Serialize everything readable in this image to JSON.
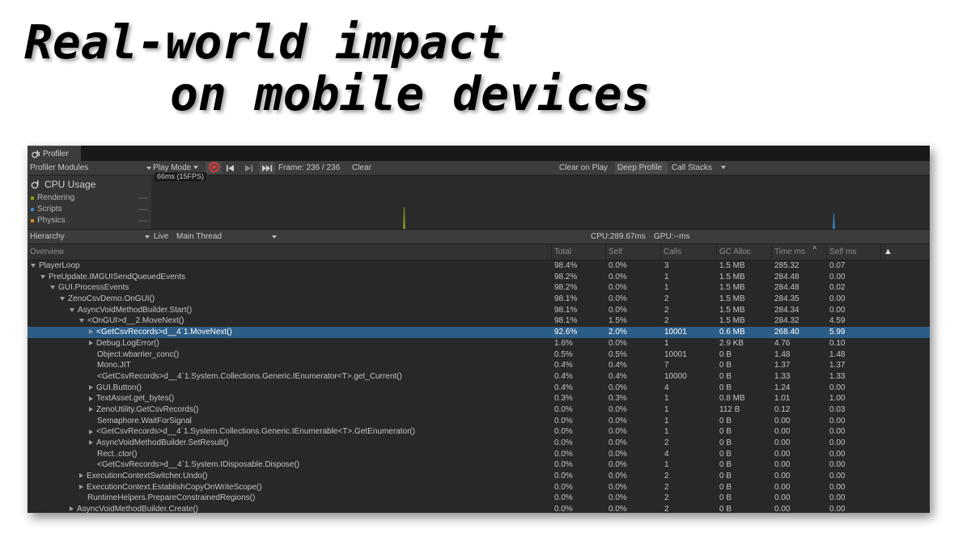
{
  "slide": {
    "title_line1": "Real-world impact",
    "title_line2": "on mobile devices"
  },
  "window": {
    "tab_label": "Profiler"
  },
  "toolbar": {
    "modules_label": "Profiler Modules",
    "play_mode": "Play Mode",
    "frame": "Frame: 236 / 236",
    "clear": "Clear",
    "clear_on_play": "Clear on Play",
    "deep_profile": "Deep Profile",
    "call_stacks": "Call Stacks"
  },
  "module": {
    "title": "CPU Usage",
    "graph_label": "66ms (15FPS)",
    "legend": [
      {
        "label": "Rendering",
        "color": "#8f9a1f"
      },
      {
        "label": "Scripts",
        "color": "#3b87c7"
      },
      {
        "label": "Physics",
        "color": "#d9892b"
      }
    ]
  },
  "hierarchy_bar": {
    "view": "Hierarchy",
    "live": "Live",
    "thread": "Main Thread",
    "cpu": "CPU:289.67ms",
    "gpu": "GPU:--ms"
  },
  "columns": [
    "Overview",
    "Total",
    "Self",
    "Calls",
    "GC Alloc",
    "Time ms",
    "Self ms",
    "▲"
  ],
  "rows": [
    {
      "name": "PlayerLoop",
      "indent": 0,
      "exp": "down",
      "total": "98.4%",
      "self": "0.0%",
      "calls": "3",
      "gc": "1.5 MB",
      "time": "285.32",
      "selfms": "0.07"
    },
    {
      "name": "PreUpdate.IMGUISendQueuedEvents",
      "indent": 1,
      "exp": "down",
      "total": "98.2%",
      "self": "0.0%",
      "calls": "1",
      "gc": "1.5 MB",
      "time": "284.48",
      "selfms": "0.00"
    },
    {
      "name": "GUI.ProcessEvents",
      "indent": 2,
      "exp": "down",
      "total": "98.2%",
      "self": "0.0%",
      "calls": "1",
      "gc": "1.5 MB",
      "time": "284.48",
      "selfms": "0.02"
    },
    {
      "name": "ZenoCsvDemo.OnGUI()",
      "indent": 3,
      "exp": "down",
      "total": "98.1%",
      "self": "0.0%",
      "calls": "2",
      "gc": "1.5 MB",
      "time": "284.35",
      "selfms": "0.00"
    },
    {
      "name": "AsyncVoidMethodBuilder.Start()",
      "indent": 4,
      "exp": "down",
      "total": "98.1%",
      "self": "0.0%",
      "calls": "2",
      "gc": "1.5 MB",
      "time": "284.34",
      "selfms": "0.00"
    },
    {
      "name": "<OnGUI>d__2.MoveNext()",
      "indent": 5,
      "exp": "down",
      "total": "98.1%",
      "self": "1.5%",
      "calls": "2",
      "gc": "1.5 MB",
      "time": "284.32",
      "selfms": "4.59"
    },
    {
      "name": "<GetCsvRecords>d__4`1.MoveNext()",
      "indent": 6,
      "exp": "right",
      "selected": true,
      "total": "92.6%",
      "self": "2.0%",
      "calls": "10001",
      "gc": "0.6 MB",
      "time": "268.40",
      "selfms": "5.99"
    },
    {
      "name": "Debug.LogError()",
      "indent": 6,
      "exp": "right",
      "total": "1.6%",
      "self": "0.0%",
      "calls": "1",
      "gc": "2.9 KB",
      "time": "4.76",
      "selfms": "0.10"
    },
    {
      "name": "Object.wbarrier_conc()",
      "indent": 6,
      "exp": "none",
      "total": "0.5%",
      "self": "0.5%",
      "calls": "10001",
      "gc": "0 B",
      "time": "1.48",
      "selfms": "1.48"
    },
    {
      "name": "Mono.JIT",
      "indent": 6,
      "exp": "none",
      "total": "0.4%",
      "self": "0.4%",
      "calls": "7",
      "gc": "0 B",
      "time": "1.37",
      "selfms": "1.37"
    },
    {
      "name": "<GetCsvRecords>d__4`1.System.Collections.Generic.IEnumerator<T>.get_Current()",
      "indent": 6,
      "exp": "none",
      "total": "0.4%",
      "self": "0.4%",
      "calls": "10000",
      "gc": "0 B",
      "time": "1.33",
      "selfms": "1.33"
    },
    {
      "name": "GUI.Button()",
      "indent": 6,
      "exp": "right",
      "total": "0.4%",
      "self": "0.0%",
      "calls": "4",
      "gc": "0 B",
      "time": "1.24",
      "selfms": "0.00"
    },
    {
      "name": "TextAsset.get_bytes()",
      "indent": 6,
      "exp": "right",
      "total": "0.3%",
      "self": "0.3%",
      "calls": "1",
      "gc": "0.8 MB",
      "time": "1.01",
      "selfms": "1.00"
    },
    {
      "name": "ZenoUtility.GetCsvRecords()",
      "indent": 6,
      "exp": "right",
      "total": "0.0%",
      "self": "0.0%",
      "calls": "1",
      "gc": "112 B",
      "time": "0.12",
      "selfms": "0.03"
    },
    {
      "name": "Semaphore.WaitForSignal",
      "indent": 6,
      "exp": "none",
      "total": "0.0%",
      "self": "0.0%",
      "calls": "1",
      "gc": "0 B",
      "time": "0.00",
      "selfms": "0.00"
    },
    {
      "name": "<GetCsvRecords>d__4`1.System.Collections.Generic.IEnumerable<T>.GetEnumerator()",
      "indent": 6,
      "exp": "right",
      "total": "0.0%",
      "self": "0.0%",
      "calls": "1",
      "gc": "0 B",
      "time": "0.00",
      "selfms": "0.00"
    },
    {
      "name": "AsyncVoidMethodBuilder.SetResult()",
      "indent": 6,
      "exp": "right",
      "total": "0.0%",
      "self": "0.0%",
      "calls": "2",
      "gc": "0 B",
      "time": "0.00",
      "selfms": "0.00"
    },
    {
      "name": "Rect..ctor()",
      "indent": 6,
      "exp": "none",
      "total": "0.0%",
      "self": "0.0%",
      "calls": "4",
      "gc": "0 B",
      "time": "0.00",
      "selfms": "0.00"
    },
    {
      "name": "<GetCsvRecords>d__4`1.System.IDisposable.Dispose()",
      "indent": 6,
      "exp": "none",
      "total": "0.0%",
      "self": "0.0%",
      "calls": "1",
      "gc": "0 B",
      "time": "0.00",
      "selfms": "0.00"
    },
    {
      "name": "ExecutionContextSwitcher.Undo()",
      "indent": 5,
      "exp": "right",
      "total": "0.0%",
      "self": "0.0%",
      "calls": "2",
      "gc": "0 B",
      "time": "0.00",
      "selfms": "0.00"
    },
    {
      "name": "ExecutionContext.EstablishCopyOnWriteScope()",
      "indent": 5,
      "exp": "right",
      "total": "0.0%",
      "self": "0.0%",
      "calls": "2",
      "gc": "0 B",
      "time": "0.00",
      "selfms": "0.00"
    },
    {
      "name": "RuntimeHelpers.PrepareConstrainedRegions()",
      "indent": 5,
      "exp": "none",
      "total": "0.0%",
      "self": "0.0%",
      "calls": "2",
      "gc": "0 B",
      "time": "0.00",
      "selfms": "0.00"
    },
    {
      "name": "AsyncVoidMethodBuilder.Create()",
      "indent": 4,
      "exp": "right",
      "total": "0.0%",
      "self": "0.0%",
      "calls": "2",
      "gc": "0 B",
      "time": "0.00",
      "selfms": "0.00"
    }
  ]
}
